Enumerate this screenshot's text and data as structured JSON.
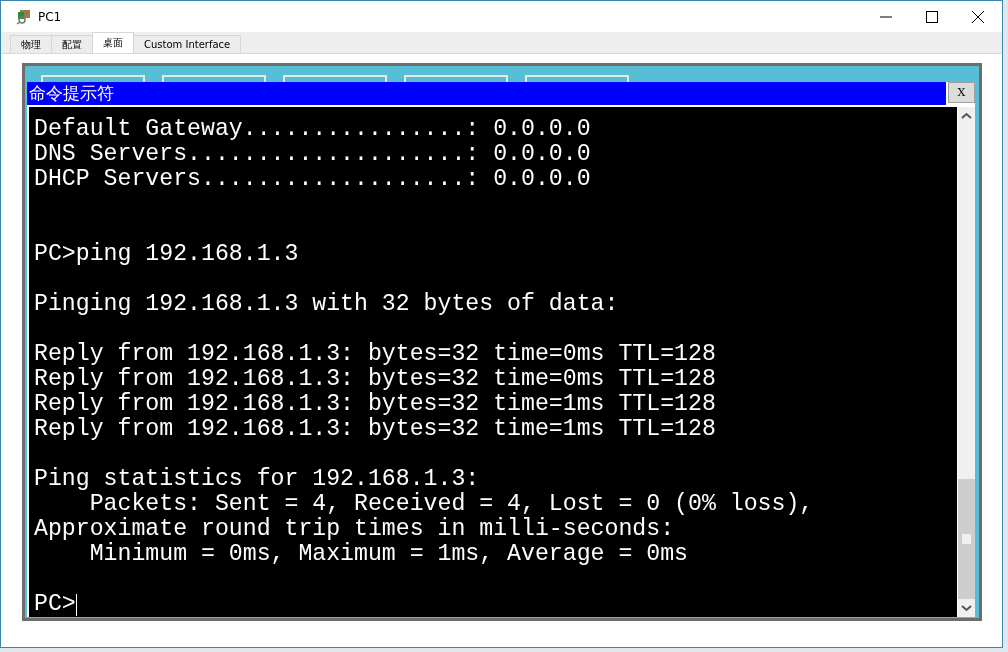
{
  "window": {
    "title": "PC1"
  },
  "tabs": [
    {
      "label": "物理",
      "selected": false
    },
    {
      "label": "配置",
      "selected": false
    },
    {
      "label": "桌面",
      "selected": true
    },
    {
      "label": "Custom Interface",
      "selected": false
    }
  ],
  "command_prompt": {
    "title": "命令提示符",
    "close_label": "X",
    "lines": [
      {
        "kind": "text",
        "text": "Default Gateway................: 0.0.0.0"
      },
      {
        "kind": "text",
        "text": "DNS Servers....................: 0.0.0.0"
      },
      {
        "kind": "text",
        "text": "DHCP Servers...................: 0.0.0.0"
      },
      {
        "kind": "blank"
      },
      {
        "kind": "blank"
      },
      {
        "kind": "text",
        "text": "PC>ping 192.168.1.3"
      },
      {
        "kind": "blank"
      },
      {
        "kind": "text",
        "text": "Pinging 192.168.1.3 with 32 bytes of data:"
      },
      {
        "kind": "blank"
      },
      {
        "kind": "text",
        "text": "Reply from 192.168.1.3: bytes=32 time=0ms TTL=128"
      },
      {
        "kind": "text",
        "text": "Reply from 192.168.1.3: bytes=32 time=0ms TTL=128"
      },
      {
        "kind": "text",
        "text": "Reply from 192.168.1.3: bytes=32 time=1ms TTL=128"
      },
      {
        "kind": "text",
        "text": "Reply from 192.168.1.3: bytes=32 time=1ms TTL=128"
      },
      {
        "kind": "blank"
      },
      {
        "kind": "text",
        "text": "Ping statistics for 192.168.1.3:"
      },
      {
        "kind": "text",
        "text": "    Packets: Sent = 4, Received = 4, Lost = 0 (0% loss),"
      },
      {
        "kind": "text",
        "text": "Approximate round trip times in milli-seconds:"
      },
      {
        "kind": "text",
        "text": "    Minimum = 0ms, Maximum = 1ms, Average = 0ms"
      },
      {
        "kind": "blank"
      },
      {
        "kind": "prompt",
        "text": "PC>"
      }
    ]
  }
}
